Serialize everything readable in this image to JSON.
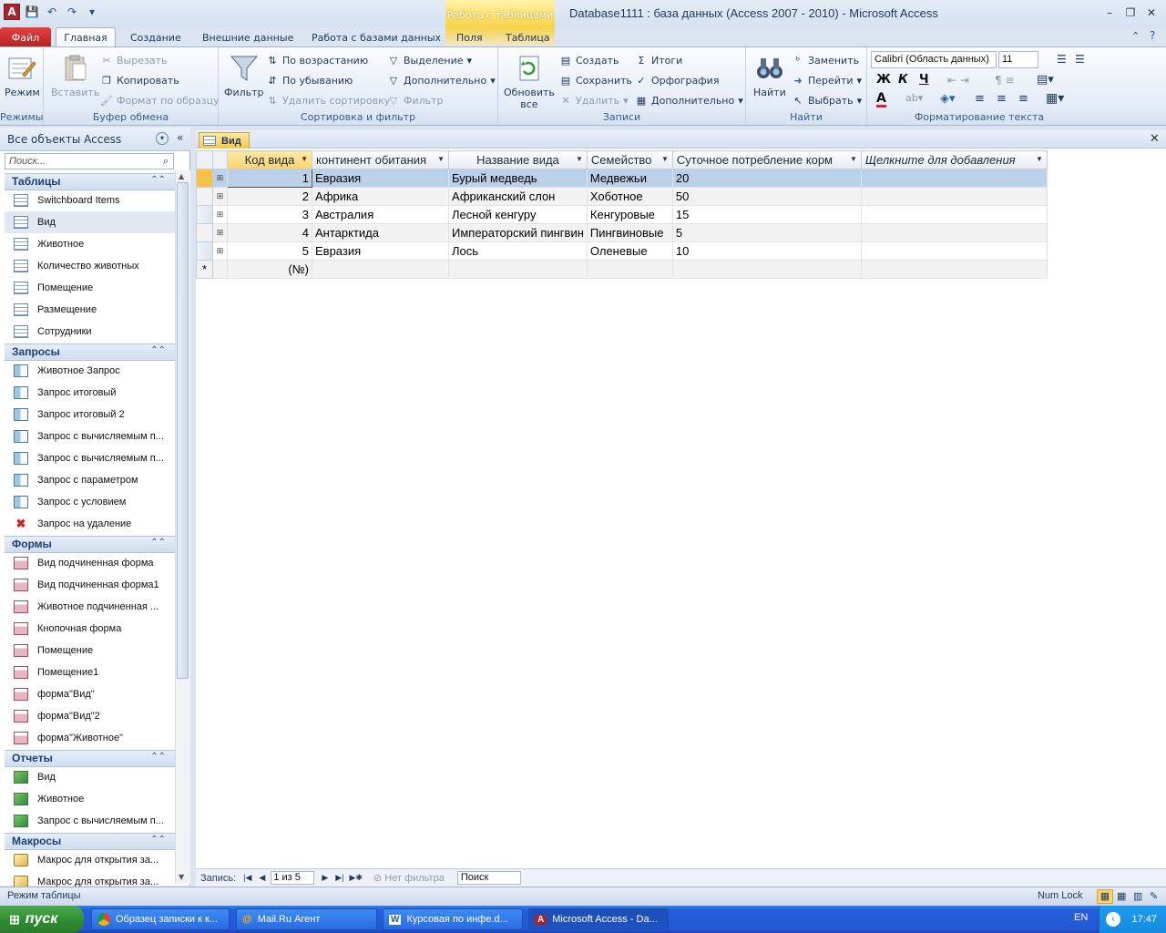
{
  "title_bar": {
    "window_title": "Database1111 : база данных (Access 2007 - 2010)  -  Microsoft Access",
    "contextual_group": "Работа с таблицами",
    "app_letter": "A",
    "minimize": "–",
    "restore": "❐",
    "close": "✕"
  },
  "tabs": {
    "file": "Файл",
    "home": "Главная",
    "create": "Создание",
    "external": "Внешние данные",
    "db_tools": "Работа с базами данных",
    "fields": "Поля",
    "table": "Таблица"
  },
  "ribbon": {
    "views": {
      "label": "Режимы",
      "view": "Режим"
    },
    "clipboard": {
      "label": "Буфер обмена",
      "paste": "Вставить",
      "cut": "Вырезать",
      "copy": "Копировать",
      "format_painter": "Формат по образцу"
    },
    "sort_filter": {
      "label": "Сортировка и фильтр",
      "filter": "Фильтр",
      "ascending": "По возрастанию",
      "descending": "По убыванию",
      "remove_sort": "Удалить сортировку",
      "selection": "Выделение",
      "advanced": "Дополнительно",
      "toggle_filter": "Фильтр"
    },
    "records": {
      "label": "Записи",
      "refresh": "Обновить",
      "refresh2": "все",
      "new": "Создать",
      "save": "Сохранить",
      "delete": "Удалить",
      "totals": "Итоги",
      "spelling": "Орфография",
      "more": "Дополнительно"
    },
    "find": {
      "label": "Найти",
      "find": "Найти",
      "replace": "Заменить",
      "goto": "Перейти",
      "select": "Выбрать"
    },
    "text_format": {
      "label": "Форматирование текста",
      "font": "Calibri (Область данных)",
      "size": "11",
      "bold": "Ж",
      "italic": "К",
      "underline": "Ч"
    }
  },
  "nav": {
    "header": "Все объекты Access",
    "search_placeholder": "Поиск...",
    "sections": [
      {
        "title": "Таблицы",
        "items": [
          "Switchboard Items",
          "Вид",
          "Животное",
          "Количество животных",
          "Помещение",
          "Размещение",
          "Сотрудники"
        ]
      },
      {
        "title": "Запросы",
        "items": [
          "Животное Запрос",
          "Запрос итоговый",
          "Запрос итоговый 2",
          "Запрос с вычисляемым п...",
          "Запрос с вычисляемым п...",
          "Запрос с параметром",
          "Запрос с условием",
          "Запрос на удаление"
        ]
      },
      {
        "title": "Формы",
        "items": [
          "Вид подчиненная форма",
          "Вид подчиненная форма1",
          "Животное подчиненная ...",
          "Кнопочная форма",
          "Помещение",
          "Помещение1",
          "форма\"Вид\"",
          "форма\"Вид\"2",
          "форма\"Животное\""
        ]
      },
      {
        "title": "Отчеты",
        "items": [
          "Вид",
          "Животное",
          "Запрос с вычисляемым п..."
        ]
      },
      {
        "title": "Макросы",
        "items": [
          "Макрос для открытия за...",
          "Макрос для открытия за..."
        ]
      }
    ]
  },
  "document": {
    "tab_label": "Вид",
    "close": "✕",
    "columns": [
      "Код вида",
      "континент обитания",
      "Название вида",
      "Семейство",
      "Суточное потребление корм",
      "Щелкните для добавления"
    ],
    "rows": [
      [
        "1",
        "Евразия",
        "Бурый медведь",
        "Медвежьи",
        "20"
      ],
      [
        "2",
        "Африка",
        "Африканский слон",
        "Хоботное",
        "50"
      ],
      [
        "3",
        "Австралия",
        "Лесной кенгуру",
        "Кенгуровые",
        "15"
      ],
      [
        "4",
        "Антарктида",
        "Императорский пингвин",
        "Пингвиновые",
        "5"
      ],
      [
        "5",
        "Евразия",
        "Лось",
        "Оленевые",
        "10"
      ]
    ],
    "new_row_marker": "*",
    "new_row_placeholder": "(№)",
    "expand": "⊞"
  },
  "record_nav": {
    "label": "Запись:",
    "position": "1 из 5",
    "filter": "Нет фильтра",
    "search": "Поиск"
  },
  "status": {
    "mode": "Режим таблицы",
    "numlock": "Num Lock"
  },
  "taskbar": {
    "start": "пуск",
    "tasks": [
      "Образец записки к к...",
      "Mail.Ru Агент",
      "Курсовая по инфе.d...",
      "Microsoft Access - Da..."
    ],
    "lang": "EN",
    "time": "17:47"
  },
  "colors": {
    "file_tab": "#c4302b",
    "contextual": "#f7d34a",
    "taskbar": "#245edb",
    "start": "#2f8a31"
  }
}
